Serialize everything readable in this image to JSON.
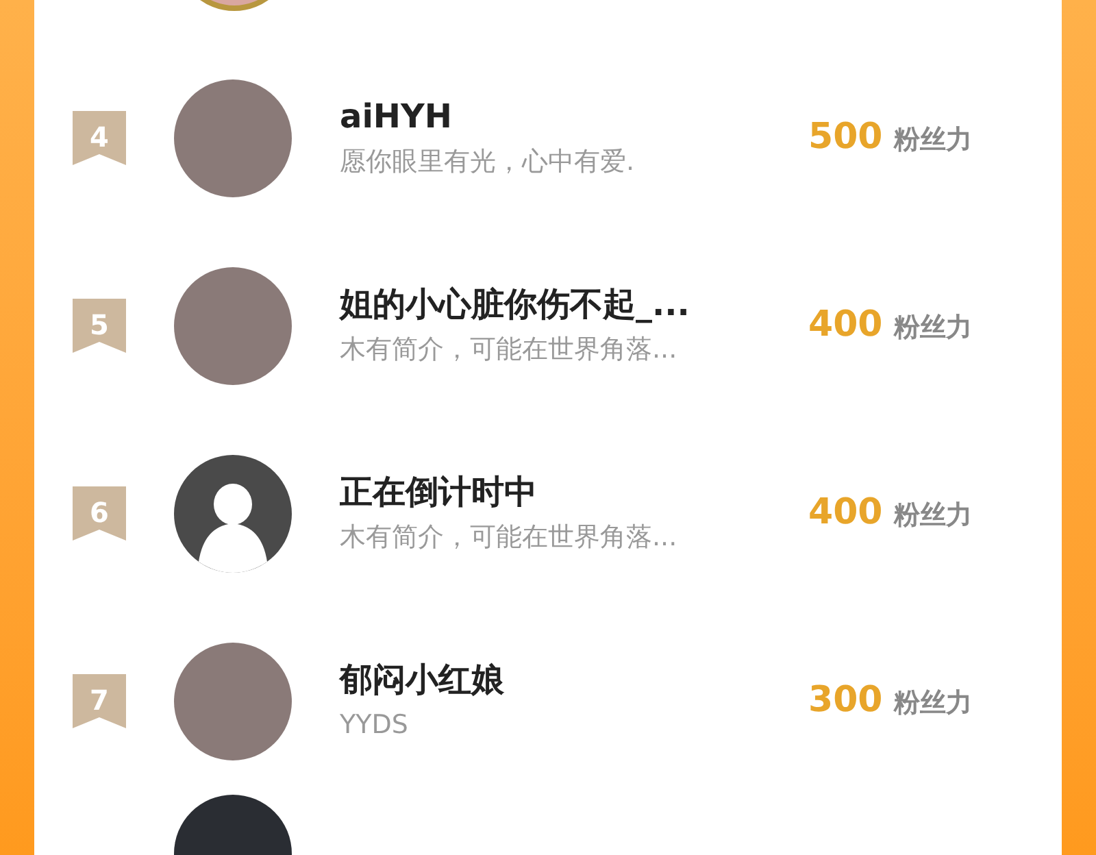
{
  "rows": [
    {
      "rank": "4",
      "kind": "photo",
      "name": "aiHYH",
      "bio": "愿你眼里有光，心中有爱.",
      "score": "500",
      "unit": "粉丝力"
    },
    {
      "rank": "5",
      "kind": "photo",
      "name": "姐的小心脏你伤不起_...",
      "bio": "木有简介，可能在世界角落...",
      "score": "400",
      "unit": "粉丝力"
    },
    {
      "rank": "6",
      "kind": "default",
      "name": "正在倒计时中",
      "bio": "木有简介，可能在世界角落...",
      "score": "400",
      "unit": "粉丝力"
    },
    {
      "rank": "7",
      "kind": "photo",
      "name": "郁闷小红娘",
      "bio": "YYDS",
      "score": "300",
      "unit": "粉丝力"
    }
  ]
}
